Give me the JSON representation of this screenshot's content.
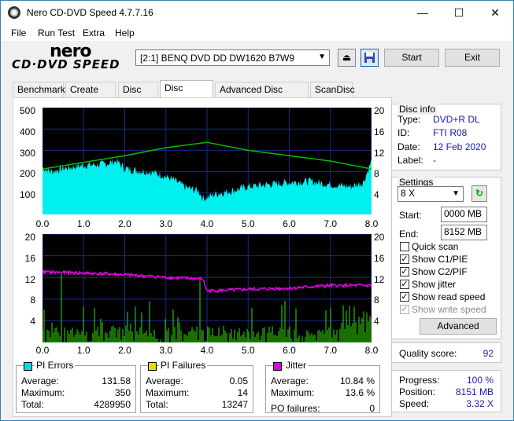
{
  "window": {
    "title": "Nero CD-DVD Speed 4.7.7.16",
    "minimize": "—",
    "maximize": "☐",
    "close": "✕"
  },
  "menu": [
    "File",
    "Run Test",
    "Extra",
    "Help"
  ],
  "logo": {
    "line1": "nero",
    "line2": "CD·DVD SPEED"
  },
  "toolbar": {
    "drive": "[2:1]  BENQ DVD DD DW1620 B7W9",
    "start_label": "Start",
    "exit_label": "Exit"
  },
  "tabs": [
    "Benchmark",
    "Create Disc",
    "Disc Info",
    "Disc Quality",
    "Advanced Disc Quality",
    "ScanDisc"
  ],
  "active_tab": "Disc Quality",
  "disc_info": {
    "heading": "Disc info",
    "type_label": "Type:",
    "type": "DVD+R DL",
    "id_label": "ID:",
    "id": "FTI R08",
    "date_label": "Date:",
    "date": "12 Feb 2020",
    "label_label": "Label:",
    "label": "-"
  },
  "settings": {
    "heading": "Settings",
    "speed": "8 X",
    "start_label": "Start:",
    "start": "0000 MB",
    "end_label": "End:",
    "end": "8152 MB",
    "quick_scan": "Quick scan",
    "show_c1": "Show C1/PIE",
    "show_c2": "Show C2/PIF",
    "show_jitter": "Show jitter",
    "show_read": "Show read speed",
    "show_write": "Show write speed",
    "advanced_label": "Advanced"
  },
  "checks": {
    "quick_scan": false,
    "show_c1": true,
    "show_c2": true,
    "show_jitter": true,
    "show_read": true,
    "show_write": true
  },
  "quality": {
    "label": "Quality score:",
    "value": "92"
  },
  "progress": {
    "progress_label": "Progress:",
    "progress": "100 %",
    "position_label": "Position:",
    "position": "8151 MB",
    "speed_label": "Speed:",
    "speed": "3.32 X"
  },
  "stats": {
    "pi_errors": {
      "title": "PI Errors",
      "avg_label": "Average:",
      "avg": "131.58",
      "max_label": "Maximum:",
      "max": "350",
      "total_label": "Total:",
      "total": "4289950",
      "color": "#00e0e0"
    },
    "pi_failures": {
      "title": "PI Failures",
      "avg_label": "Average:",
      "avg": "0.05",
      "max_label": "Maximum:",
      "max": "14",
      "total_label": "Total:",
      "total": "13247",
      "color": "#e0e000"
    },
    "jitter": {
      "title": "Jitter",
      "avg_label": "Average:",
      "avg": "10.84 %",
      "max_label": "Maximum:",
      "max": "13.6 %",
      "po_label": "PO failures:",
      "po": "0",
      "color": "#e000e0"
    }
  },
  "chart_data": [
    {
      "type": "area",
      "x_ticks": [
        "0.0",
        "1.0",
        "2.0",
        "3.0",
        "4.0",
        "5.0",
        "6.0",
        "7.0",
        "8.0"
      ],
      "y_left_ticks": [
        "500",
        "400",
        "300",
        "200",
        "100"
      ],
      "y_right_ticks": [
        "20",
        "16",
        "12",
        "8",
        "4"
      ],
      "xlim": [
        0,
        8
      ],
      "ylim_left": [
        0,
        500
      ],
      "ylim_right": [
        0,
        20
      ],
      "series": [
        {
          "values_x": [
            0,
            0.2,
            0.5,
            1.0,
            1.5,
            1.8,
            2.0,
            2.3,
            2.6,
            2.9,
            3.2,
            3.5,
            3.8,
            3.9,
            4.0,
            4.2,
            4.6,
            5.0,
            5.5,
            6.0,
            6.5,
            7.0,
            7.5,
            7.8,
            8.0
          ],
          "values_y": [
            220,
            200,
            215,
            230,
            235,
            250,
            215,
            205,
            200,
            185,
            160,
            125,
            110,
            75,
            80,
            95,
            110,
            130,
            140,
            150,
            155,
            140,
            130,
            150,
            250
          ],
          "color": "#00f0f0"
        },
        {
          "values_x": [
            0,
            2,
            3,
            4,
            5,
            6,
            7,
            8
          ],
          "values_y": [
            8.5,
            11,
            12.5,
            13.5,
            12,
            11,
            10,
            8.5
          ],
          "color": "#00c000"
        }
      ]
    },
    {
      "type": "bar",
      "x_ticks": [
        "0.0",
        "1.0",
        "2.0",
        "3.0",
        "4.0",
        "5.0",
        "6.0",
        "7.0",
        "8.0"
      ],
      "y_left_ticks": [
        "20",
        "16",
        "12",
        "8",
        "4"
      ],
      "y_right_ticks": [
        "20",
        "16",
        "12",
        "8",
        "4"
      ],
      "xlim": [
        0,
        8
      ],
      "ylim": [
        0,
        20
      ],
      "series": [
        {
          "values_x": [
            0,
            1,
            2,
            3,
            3.9,
            4.0,
            5,
            6,
            7,
            8
          ],
          "values_y": [
            13,
            12.8,
            12.5,
            12,
            11.7,
            9.5,
            9.8,
            10,
            10.5,
            10.5
          ],
          "color": "#e000e0"
        }
      ],
      "pif_max": 14
    }
  ]
}
